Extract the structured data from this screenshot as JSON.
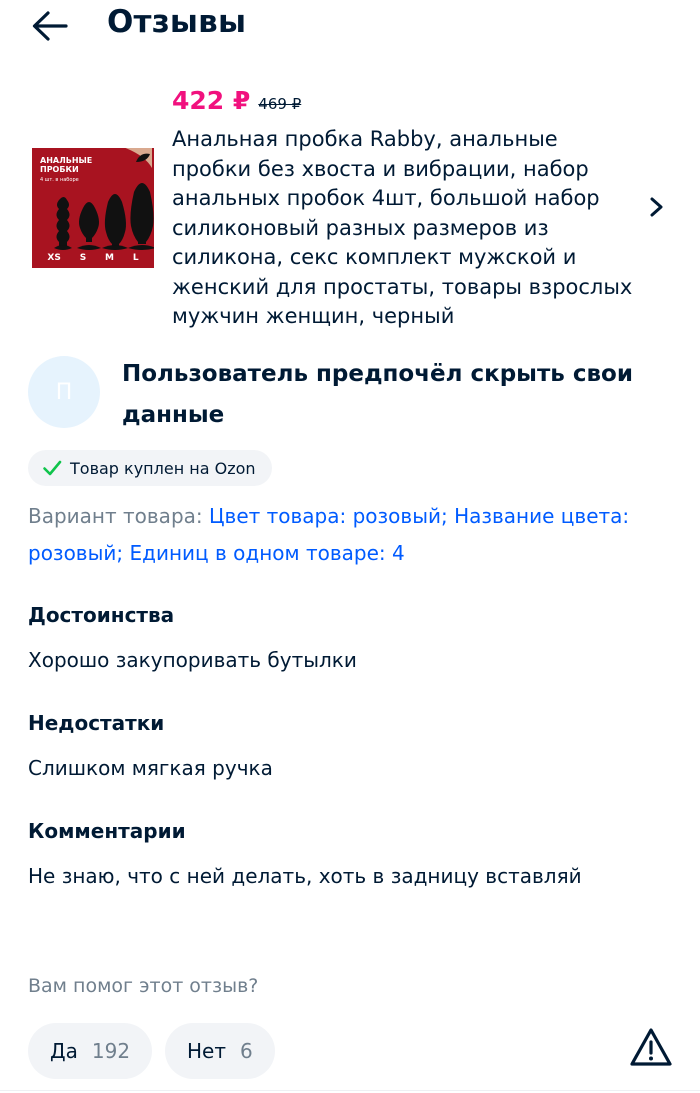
{
  "header": {
    "title": "Отзывы",
    "back_icon": "arrow-left-icon"
  },
  "product": {
    "price": "422 ₽",
    "old_price": "469 ₽",
    "name": "Анальная пробка Rabby, анальные пробки без хвоста и вибрации, набор анальных пробок 4шт, большой набор силиконовый разных размеров из силикона, секс комплект мужской и женский для простаты, товары взрослых мужчин женщин, черный",
    "thumbnail": {
      "label": "АНАЛЬНЫЕ\nПРОБКИ",
      "sublabel": "4 шт. в наборе",
      "sizes": [
        "XS",
        "S",
        "M",
        "L"
      ]
    },
    "chevron_icon": "chevron-right-icon"
  },
  "review": {
    "avatar_letter": "П",
    "user_name": "Пользователь предпочёл скрыть свои данные",
    "badge": "Товар куплен на Ozon",
    "variant_label": "Вариант товара:",
    "variant_value": "Цвет товара: розовый; Название цвета: розовый; Единиц в одном товаре: 4",
    "pros_title": "Достоинства",
    "pros_text": "Хорошо закупоривать бутылки",
    "cons_title": "Недостатки",
    "cons_text": "Слишком мягкая ручка",
    "comment_title": "Комментарии",
    "comment_text": "Не знаю, что с ней делать, хоть в задницу вставляй"
  },
  "helpful": {
    "question": "Вам помог этот отзыв?",
    "yes_label": "Да",
    "yes_count": "192",
    "no_label": "Нет",
    "no_count": "6",
    "report_icon": "warning-triangle-icon"
  },
  "colors": {
    "price": "#f1117e",
    "link": "#005bff",
    "text": "#001a34",
    "muted": "#707f8d",
    "badge_check": "#10c44c"
  }
}
